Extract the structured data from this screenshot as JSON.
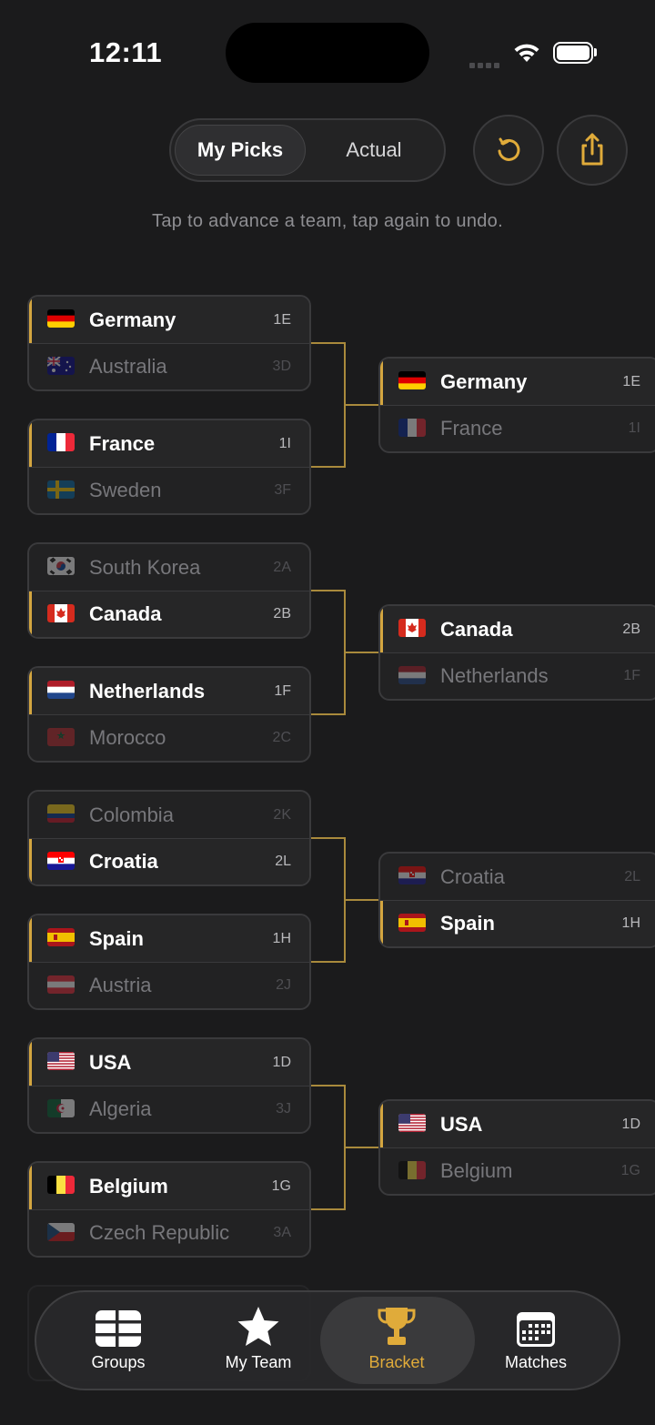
{
  "status_bar": {
    "time": "12:11"
  },
  "header": {
    "segments": [
      {
        "label": "My Picks",
        "selected": true
      },
      {
        "label": "Actual",
        "selected": false
      }
    ],
    "reset_icon": "reset-icon",
    "share_icon": "share-icon",
    "hint": "Tap to advance a team, tap again to undo."
  },
  "accent_color": "#d4a640",
  "round_of_32": [
    {
      "top": {
        "team": "Germany",
        "seed": "1E",
        "flag": "germany",
        "winner": true
      },
      "bottom": {
        "team": "Australia",
        "seed": "3D",
        "flag": "australia",
        "winner": false
      }
    },
    {
      "top": {
        "team": "France",
        "seed": "1I",
        "flag": "france",
        "winner": true
      },
      "bottom": {
        "team": "Sweden",
        "seed": "3F",
        "flag": "sweden",
        "winner": false
      }
    },
    {
      "top": {
        "team": "South Korea",
        "seed": "2A",
        "flag": "south-korea",
        "winner": false
      },
      "bottom": {
        "team": "Canada",
        "seed": "2B",
        "flag": "canada",
        "winner": true
      }
    },
    {
      "top": {
        "team": "Netherlands",
        "seed": "1F",
        "flag": "netherlands",
        "winner": true
      },
      "bottom": {
        "team": "Morocco",
        "seed": "2C",
        "flag": "morocco",
        "winner": false
      }
    },
    {
      "top": {
        "team": "Colombia",
        "seed": "2K",
        "flag": "colombia",
        "winner": false
      },
      "bottom": {
        "team": "Croatia",
        "seed": "2L",
        "flag": "croatia",
        "winner": true
      }
    },
    {
      "top": {
        "team": "Spain",
        "seed": "1H",
        "flag": "spain",
        "winner": true
      },
      "bottom": {
        "team": "Austria",
        "seed": "2J",
        "flag": "austria",
        "winner": false
      }
    },
    {
      "top": {
        "team": "USA",
        "seed": "1D",
        "flag": "usa",
        "winner": true
      },
      "bottom": {
        "team": "Algeria",
        "seed": "3J",
        "flag": "algeria",
        "winner": false
      }
    },
    {
      "top": {
        "team": "Belgium",
        "seed": "1G",
        "flag": "belgium",
        "winner": true
      },
      "bottom": {
        "team": "Czech Republic",
        "seed": "3A",
        "flag": "czech",
        "winner": false
      }
    }
  ],
  "round_of_16": [
    {
      "top": {
        "team": "Germany",
        "seed": "1E",
        "flag": "germany",
        "winner": true
      },
      "bottom": {
        "team": "France",
        "seed": "1I",
        "flag": "france",
        "winner": false
      }
    },
    {
      "top": {
        "team": "Canada",
        "seed": "2B",
        "flag": "canada",
        "winner": true
      },
      "bottom": {
        "team": "Netherlands",
        "seed": "1F",
        "flag": "netherlands",
        "winner": false
      }
    },
    {
      "top": {
        "team": "Croatia",
        "seed": "2L",
        "flag": "croatia",
        "winner": false
      },
      "bottom": {
        "team": "Spain",
        "seed": "1H",
        "flag": "spain",
        "winner": true
      }
    },
    {
      "top": {
        "team": "USA",
        "seed": "1D",
        "flag": "usa",
        "winner": true
      },
      "bottom": {
        "team": "Belgium",
        "seed": "1G",
        "flag": "belgium",
        "winner": false
      }
    }
  ],
  "tab_bar": [
    {
      "label": "Groups",
      "icon": "grid-icon",
      "selected": false
    },
    {
      "label": "My Team",
      "icon": "star-icon",
      "selected": false
    },
    {
      "label": "Bracket",
      "icon": "trophy-icon",
      "selected": true
    },
    {
      "label": "Matches",
      "icon": "calendar-icon",
      "selected": false
    }
  ]
}
